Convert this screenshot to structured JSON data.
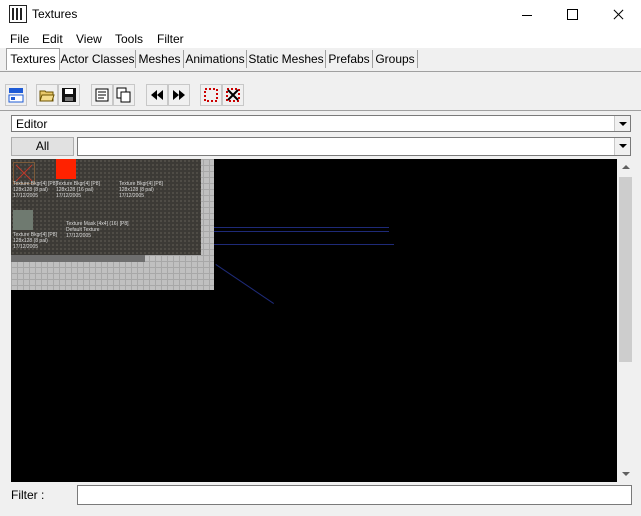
{
  "window": {
    "title": "Textures",
    "app_icon": "unreal-editor-icon"
  },
  "menu": [
    "File",
    "Edit",
    "View",
    "Tools",
    "Filter"
  ],
  "tabs": [
    {
      "label": "Textures",
      "active": true
    },
    {
      "label": "Actor Classes",
      "active": false
    },
    {
      "label": "Meshes",
      "active": false
    },
    {
      "label": "Animations",
      "active": false
    },
    {
      "label": "Static Meshes",
      "active": false
    },
    {
      "label": "Prefabs",
      "active": false
    },
    {
      "label": "Groups",
      "active": false
    }
  ],
  "toolbar": {
    "icons": [
      "dock-icon",
      "open-folder-icon",
      "save-icon",
      "properties-icon",
      "copy-icon",
      "previous-icon",
      "next-icon",
      "select-frame-icon",
      "clear-frame-icon"
    ]
  },
  "package_combo": {
    "value": "Editor"
  },
  "group": {
    "all_label": "All",
    "value": ""
  },
  "textures": [
    {
      "name": "Texture Bkgr[4] [P8]",
      "size": "128x128 (8 pal)",
      "date": "17/12/2005",
      "color": "#4a3b2a"
    },
    {
      "name": "Texture Bkgr[4] [P8]",
      "size": "128x128 (16 pal)",
      "date": "17/12/2005",
      "color": "#ff2200"
    },
    {
      "name": "Texture Bkgr[4] [P8]",
      "size": "128x128 (8 pal)",
      "date": "17/12/2005",
      "color": "#3c3a36"
    },
    {
      "name": "Texture Bkgr[4] [P8]",
      "size": "128x128 (8 pal)",
      "date": "17/12/2005",
      "color": "#6f7a70"
    },
    {
      "name": "Texture Mask [4x4] (16) [P8]",
      "size": "Default Texture",
      "date": "17/12/2005",
      "color": "#3c3a36"
    }
  ],
  "colors": {
    "viewport_bg": "#000000",
    "tab_border": "#a0a0a0",
    "toolbar_red": "#cc0000"
  },
  "filter": {
    "label": "Filter :",
    "value": ""
  }
}
